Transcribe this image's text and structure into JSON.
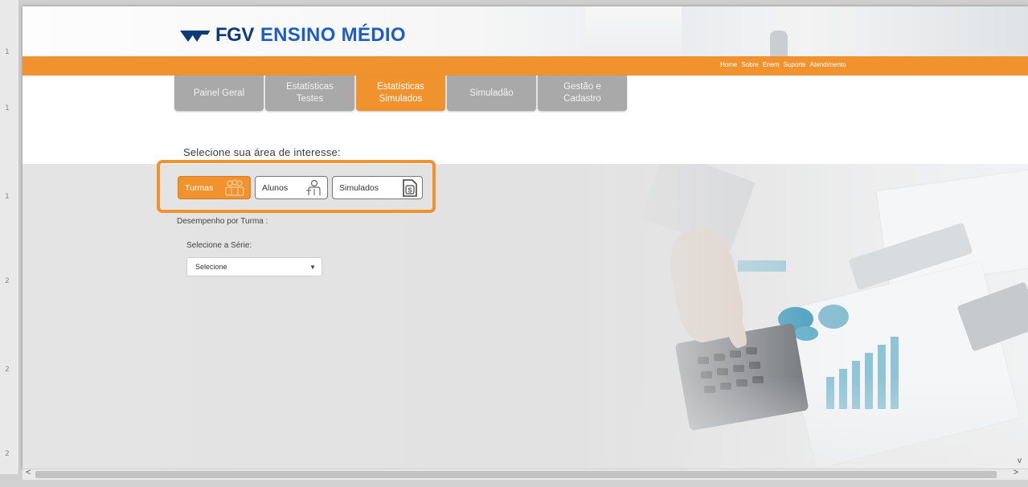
{
  "header": {
    "logo_fgv": "FGV",
    "logo_rest": "ENSINO MÉDIO",
    "top_links": [
      "Home",
      "Sobre",
      "Enem",
      "Suporte",
      "Atendimento"
    ]
  },
  "tabs": [
    {
      "label": "Painel Geral",
      "active": false
    },
    {
      "label": "Estatísticas Testes",
      "active": false
    },
    {
      "label": "Estatísticas Simulados",
      "active": true
    },
    {
      "label": "Simuladão",
      "active": false
    },
    {
      "label": "Gestão e Cadastro",
      "active": false
    }
  ],
  "intro": "Selecione sua área de interesse:",
  "area_buttons": [
    {
      "label": "Turmas",
      "icon": "group-icon",
      "active": true
    },
    {
      "label": "Alunos",
      "icon": "student-icon",
      "active": false
    },
    {
      "label": "Simulados",
      "icon": "document-s-icon",
      "active": false
    }
  ],
  "section_title": "Desempenho por Turma :",
  "serie": {
    "label": "Selecione a Série:",
    "value": "Selecione"
  },
  "colors": {
    "accent": "#f0932e",
    "tab_inactive": "#a9a9a9",
    "logo_dark": "#0c3a7a",
    "logo_blue": "#1f5cc4"
  }
}
